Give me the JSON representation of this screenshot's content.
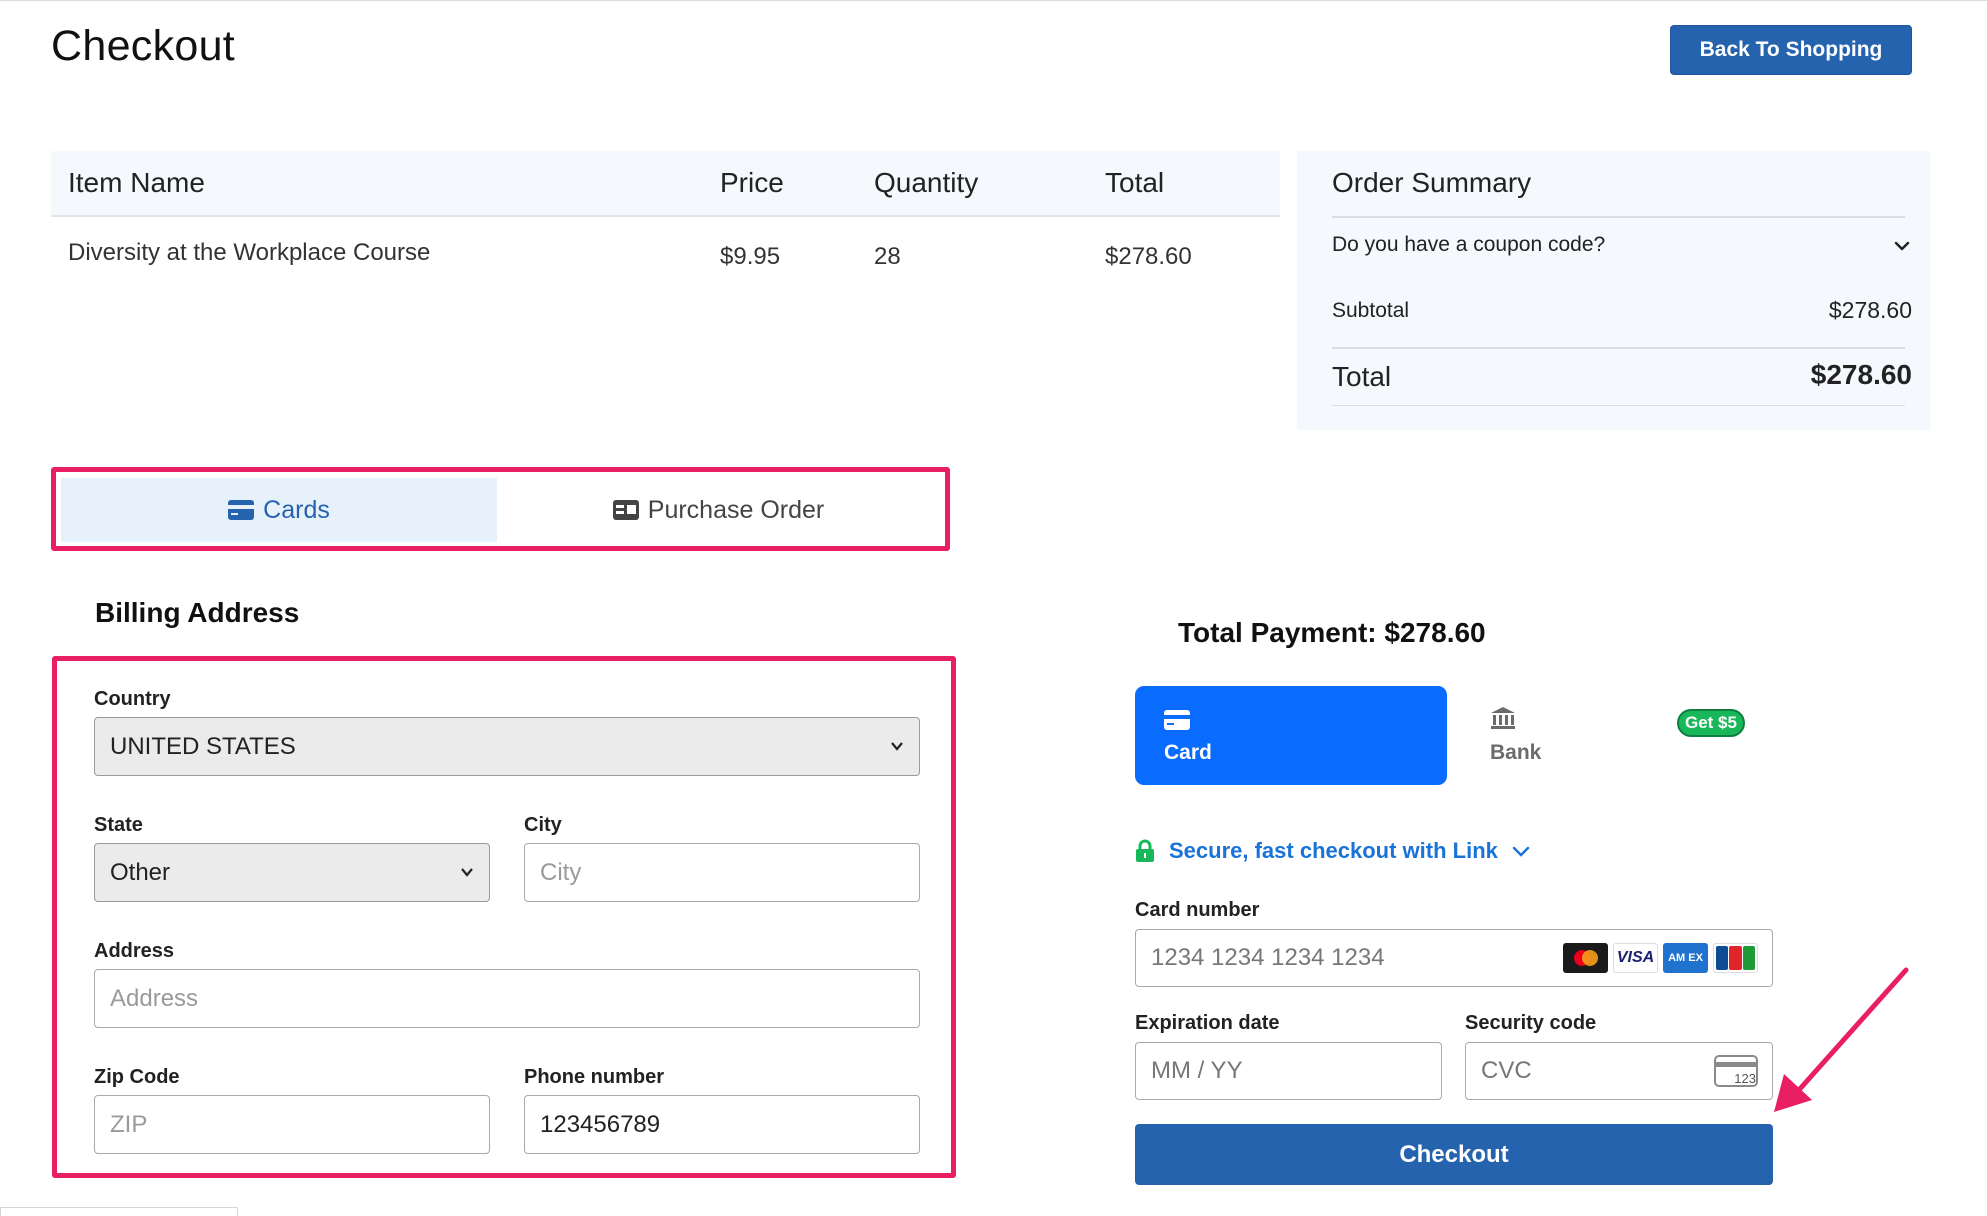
{
  "header": {
    "title": "Checkout",
    "back_button": "Back To Shopping"
  },
  "items_table": {
    "columns": [
      "Item Name",
      "Price",
      "Quantity",
      "Total"
    ],
    "rows": [
      {
        "name": "Diversity at the Workplace Course",
        "price": "$9.95",
        "quantity": "28",
        "total": "$278.60"
      }
    ]
  },
  "order_summary": {
    "title": "Order Summary",
    "coupon_prompt": "Do you have a coupon code?",
    "subtotal_label": "Subtotal",
    "subtotal_value": "$278.60",
    "total_label": "Total",
    "total_value": "$278.60"
  },
  "payment_tabs": {
    "active": "Cards",
    "items": [
      {
        "label": "Cards",
        "icon": "credit-card-icon"
      },
      {
        "label": "Purchase Order",
        "icon": "id-card-icon"
      }
    ]
  },
  "billing": {
    "title": "Billing Address",
    "country": {
      "label": "Country",
      "value": "UNITED STATES"
    },
    "state": {
      "label": "State",
      "value": "Other"
    },
    "city": {
      "label": "City",
      "placeholder": "City",
      "value": ""
    },
    "address": {
      "label": "Address",
      "placeholder": "Address",
      "value": ""
    },
    "zip": {
      "label": "Zip Code",
      "placeholder": "ZIP",
      "value": ""
    },
    "phone": {
      "label": "Phone number",
      "value": "123456789"
    }
  },
  "stripe": {
    "total_payment": "Total Payment: $278.60",
    "methods": [
      {
        "label": "Card",
        "icon": "card-icon",
        "active": true
      },
      {
        "label": "Bank",
        "icon": "bank-icon",
        "active": false
      }
    ],
    "promo_badge": "Get $5",
    "link_text": "Secure, fast checkout with Link",
    "card_number": {
      "label": "Card number",
      "placeholder": "1234 1234 1234 1234"
    },
    "card_brands": [
      "mastercard-icon",
      "visa-icon",
      "amex-icon",
      "jcb-icon"
    ],
    "expiration": {
      "label": "Expiration date",
      "placeholder": "MM / YY"
    },
    "security": {
      "label": "Security code",
      "placeholder": "CVC",
      "icon_text": "123"
    },
    "checkout_button": "Checkout"
  },
  "colors": {
    "primary": "#2663ae",
    "stripe_blue": "#0a6cff",
    "highlight": "#ea1f63",
    "tab_active_bg": "#e6f1fb",
    "summary_bg": "#f5f8fc",
    "badge_green": "#18b85a"
  }
}
